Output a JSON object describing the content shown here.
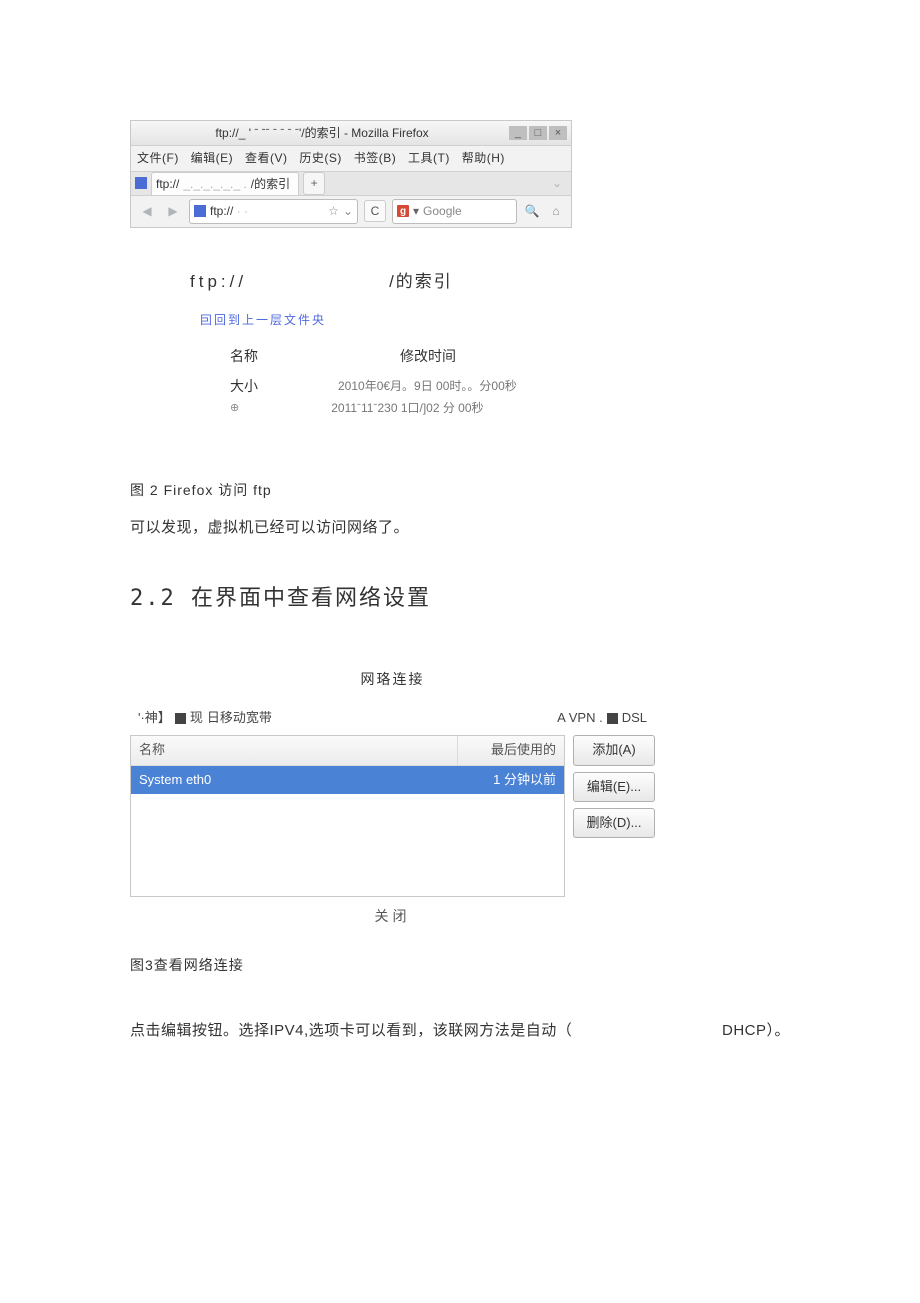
{
  "firefox": {
    "title_prefix": "ftp://_   ' ˉ ˉˉ ˉ ˉ ˉ ˉ'",
    "title_suffix": "/的索引 - Mozilla Firefox",
    "menu": {
      "file": "文件(F)",
      "edit": "编辑(E)",
      "view": "查看(V)",
      "history": "历史(S)",
      "bookmarks": "书签(B)",
      "tools": "工具(T)",
      "help": "帮助(H)"
    },
    "tab": {
      "prefix": "ftp://",
      "mid": "_._._._._._ .",
      "suffix": "/的索引"
    },
    "url": {
      "scheme": "ftp://",
      "rest": "·  ·"
    },
    "star": "☆",
    "dropdown": "⌄",
    "reload": "C",
    "search_placeholder": "Google",
    "winbtn": {
      "min": "_",
      "max": "□",
      "close": "×"
    }
  },
  "listing": {
    "path_prefix": "ftp://",
    "path_suffix": "/的索引",
    "up_link": "囙回到上一层文件央",
    "col_name": "名称",
    "col_time": "修改时间",
    "size_label": "大小",
    "rows": [
      "2010年0€月。9日 00时。。分00秒",
      "2011ˉ11ˉ230 1口/]02 分 00秒"
    ],
    "sym": "⊕"
  },
  "doc": {
    "fig2": "图 2 Firefox 访问 ftp",
    "body1": "可以发现，虚拟机已经可以访问网络了。",
    "sec_no": "2.2",
    "sec_title": "在界面中查看网络设置",
    "fig3": "图3查看网络连接",
    "body2_left": "点击编辑按钮。选择IPV4,选项卡可以看到，该联网方法是自动（",
    "body2_right": "DHCP）。"
  },
  "net": {
    "title": "网珞连接",
    "tabs": {
      "t1": "'·神】",
      "t2": "现",
      "t3": "日移动宽带",
      "t4": "A VPN .",
      "t5": "DSL"
    },
    "cols": {
      "name": "名称",
      "last": "最后使用的"
    },
    "row": {
      "name": "System eth0",
      "last": "1 分钟以前"
    },
    "btns": {
      "add": "添加(A)",
      "edit": "编辑(E)...",
      "delete": "删除(D)..."
    },
    "close": "关闭"
  }
}
